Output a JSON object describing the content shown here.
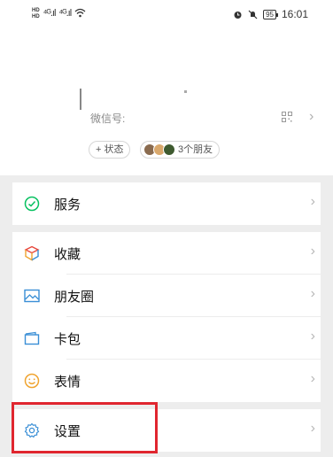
{
  "status_bar": {
    "hd1": "HD",
    "hd2": "HD",
    "signal1": "⁴ᴳ.ıl",
    "signal2": "⁴ᴳ.ıl",
    "wifi_icon": "wifi-icon",
    "battery": "95",
    "time": "16:01"
  },
  "profile": {
    "wechat_id_label": "微信号:",
    "status_button": "+ 状态",
    "friends_label": "3个朋友"
  },
  "menu": {
    "services": "服务",
    "favorites": "收藏",
    "moments": "朋友圈",
    "cards": "卡包",
    "stickers": "表情",
    "settings": "设置"
  },
  "colors": {
    "accent_green": "#07c160",
    "highlight_red": "#e0262f",
    "icon_blue": "#3a8fd6"
  }
}
